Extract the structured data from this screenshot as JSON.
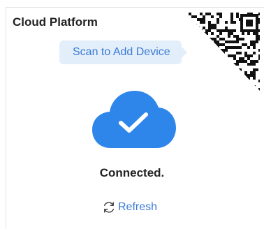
{
  "panel": {
    "title": "Cloud Platform",
    "scan_tip": "Scan to Add Device",
    "status_text": "Connected.",
    "refresh_label": "Refresh"
  },
  "icons": {
    "qr": "qr-code-icon",
    "cloud": "cloud-check-icon",
    "refresh": "refresh-icon"
  },
  "colors": {
    "accent": "#3a7bd5",
    "cloud": "#2f86ea",
    "tip_background": "#e3eefb",
    "text": "#222222"
  }
}
